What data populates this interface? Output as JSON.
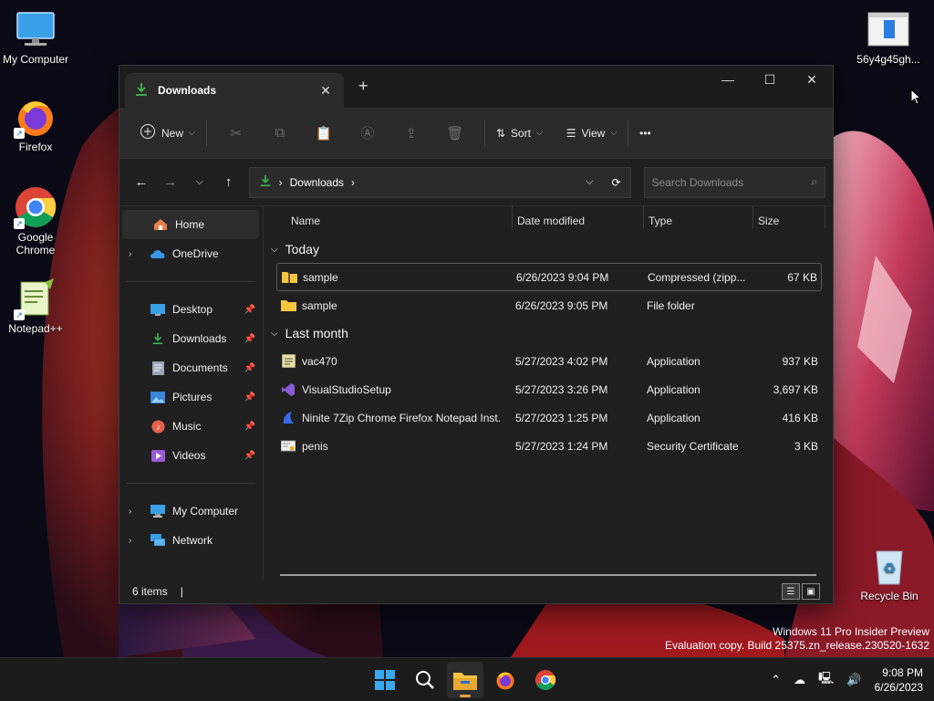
{
  "desktop": {
    "icons_left": [
      {
        "label": "My Computer",
        "icon": "monitor-icon"
      },
      {
        "label": "Firefox",
        "icon": "firefox-icon"
      },
      {
        "label": "Google Chrome",
        "icon": "chrome-icon"
      },
      {
        "label": "Notepad++",
        "icon": "notepadpp-icon"
      }
    ],
    "icon_top_right": {
      "label": "56y4g45gh...",
      "icon": "file-icon"
    },
    "recycle_bin": {
      "label": "Recycle Bin",
      "icon": "recycle-bin-icon"
    },
    "watermark": {
      "line1": "Windows 11 Pro Insider Preview",
      "line2": "Evaluation copy. Build 25375.zn_release.230520-1632"
    }
  },
  "explorer": {
    "tab_title": "Downloads",
    "new_tab_symbol": "+",
    "toolbar": {
      "new_label": "New",
      "sort_label": "Sort",
      "view_label": "View",
      "more_label": "•••"
    },
    "address": {
      "path": "Downloads",
      "sep": "›",
      "search_placeholder": "Search Downloads"
    },
    "sidebar": {
      "top": [
        {
          "label": "Home",
          "icon": "home-icon",
          "active": true,
          "expander": ""
        },
        {
          "label": "OneDrive",
          "icon": "onedrive-icon",
          "active": false,
          "expander": "›"
        }
      ],
      "pinned": [
        {
          "label": "Desktop",
          "icon": "desktop-folder-icon"
        },
        {
          "label": "Downloads",
          "icon": "downloads-icon"
        },
        {
          "label": "Documents",
          "icon": "documents-icon"
        },
        {
          "label": "Pictures",
          "icon": "pictures-icon"
        },
        {
          "label": "Music",
          "icon": "music-icon"
        },
        {
          "label": "Videos",
          "icon": "videos-icon"
        }
      ],
      "bottom": [
        {
          "label": "My Computer",
          "icon": "computer-icon"
        },
        {
          "label": "Network",
          "icon": "network-icon"
        }
      ]
    },
    "columns": {
      "name": "Name",
      "date": "Date modified",
      "type": "Type",
      "size": "Size"
    },
    "groups": [
      {
        "label": "Today",
        "files": [
          {
            "name": "sample",
            "date": "6/26/2023 9:04 PM",
            "type": "Compressed (zipp...",
            "size": "67 KB",
            "icon": "zip-folder-icon",
            "selected": true
          },
          {
            "name": "sample",
            "date": "6/26/2023 9:05 PM",
            "type": "File folder",
            "size": "",
            "icon": "folder-icon",
            "selected": false
          }
        ]
      },
      {
        "label": "Last month",
        "files": [
          {
            "name": "vac470",
            "date": "5/27/2023 4:02 PM",
            "type": "Application",
            "size": "937 KB",
            "icon": "app-icon",
            "selected": false
          },
          {
            "name": "VisualStudioSetup",
            "date": "5/27/2023 3:26 PM",
            "type": "Application",
            "size": "3,697 KB",
            "icon": "visual-studio-icon",
            "selected": false
          },
          {
            "name": "Ninite 7Zip Chrome Firefox Notepad Inst...",
            "date": "5/27/2023 1:25 PM",
            "type": "Application",
            "size": "416 KB",
            "icon": "ninite-icon",
            "selected": false
          },
          {
            "name": "penis",
            "date": "5/27/2023 1:24 PM",
            "type": "Security Certificate",
            "size": "3 KB",
            "icon": "certificate-icon",
            "selected": false
          }
        ]
      }
    ],
    "status": {
      "items": "6 items",
      "cursor": "|"
    }
  },
  "taskbar": {
    "apps": [
      "windows-start-icon",
      "search-icon",
      "file-explorer-icon",
      "firefox-icon",
      "chrome-icon"
    ],
    "clock": {
      "time": "9:08 PM",
      "date": "6/26/2023"
    }
  },
  "colors": {
    "window_bg": "#202020",
    "toolbar_bg": "#2b2b2b",
    "accent_download": "#3fb950",
    "folder": "#f5c542"
  }
}
